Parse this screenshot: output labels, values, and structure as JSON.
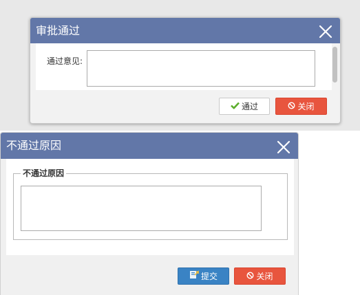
{
  "approve_dialog": {
    "title": "审批通过",
    "comment_label": "通过意见:",
    "comment_value": "",
    "pass_button": "通过",
    "close_button": "关闭",
    "icons": {
      "close": "close-icon",
      "pass": "check-icon",
      "cancel": "ban-icon"
    }
  },
  "reject_dialog": {
    "title": "不通过原因",
    "group_legend": "不通过原因",
    "reason_value": "",
    "submit_button": "提交",
    "close_button": "关闭",
    "icons": {
      "close": "close-icon",
      "submit": "submit-icon",
      "cancel": "ban-icon"
    }
  },
  "colors": {
    "title_bar": "#6277a8",
    "submit_button": "#3a83c4",
    "close_button": "#e8553e",
    "check_icon": "#5cae2d"
  }
}
